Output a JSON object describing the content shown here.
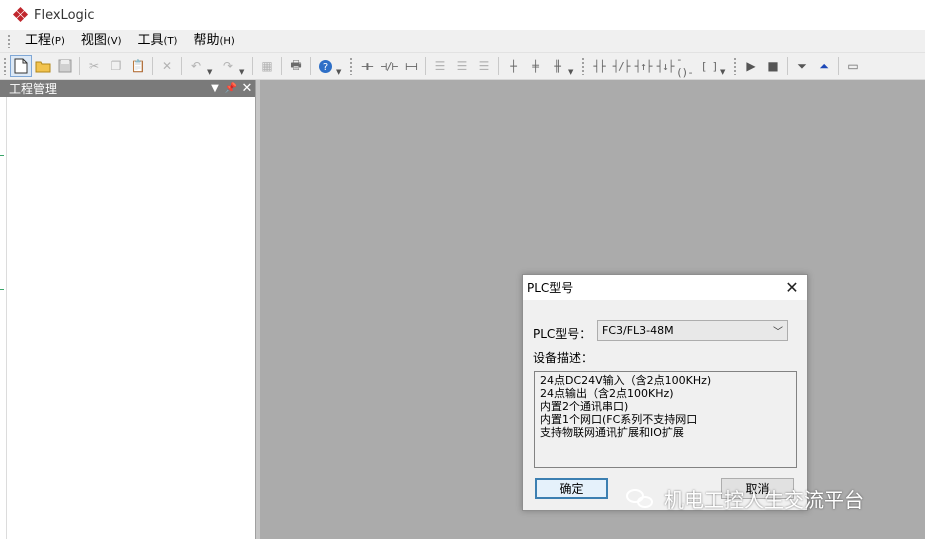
{
  "app": {
    "title": "FlexLogic"
  },
  "menu": [
    {
      "label": "工程",
      "hotkey": "(P)"
    },
    {
      "label": "视图",
      "hotkey": "(V)"
    },
    {
      "label": "工具",
      "hotkey": "(T)"
    },
    {
      "label": "帮助",
      "hotkey": "(H)"
    }
  ],
  "toolbar": {
    "new_icon": "new-file-icon",
    "open_icon": "open-folder-icon",
    "save_icon": "save-icon",
    "cut_icon": "cut-icon",
    "copy_icon": "copy-icon",
    "paste_icon": "paste-icon",
    "delete_icon": "delete-icon",
    "undo_icon": "undo-icon",
    "redo_icon": "redo-icon",
    "print_icon": "print-icon",
    "help_icon": "help-icon",
    "run_icon": "run-icon",
    "stop_icon": "stop-icon"
  },
  "panel": {
    "title": "工程管理"
  },
  "dialog": {
    "title": "PLC型号",
    "model_label": "PLC型号：",
    "model_value": "FC3/FL3-48M",
    "desc_label": "设备描述：",
    "description": [
      "24点DC24V输入（含2点100KHz)",
      "24点输出（含2点100KHz)",
      "内置2个通讯串口)",
      "内置1个网口(FC系列不支持网口",
      "支持物联网通讯扩展和IO扩展"
    ],
    "ok_label": "确定",
    "cancel_label": "取消"
  },
  "watermark": {
    "text": "机电工控人生交流平台"
  },
  "colors": {
    "logo": "#c0272d",
    "panel_header": "#7a7a7a",
    "workspace": "#ababab",
    "ok_border": "#3c7fb1"
  }
}
